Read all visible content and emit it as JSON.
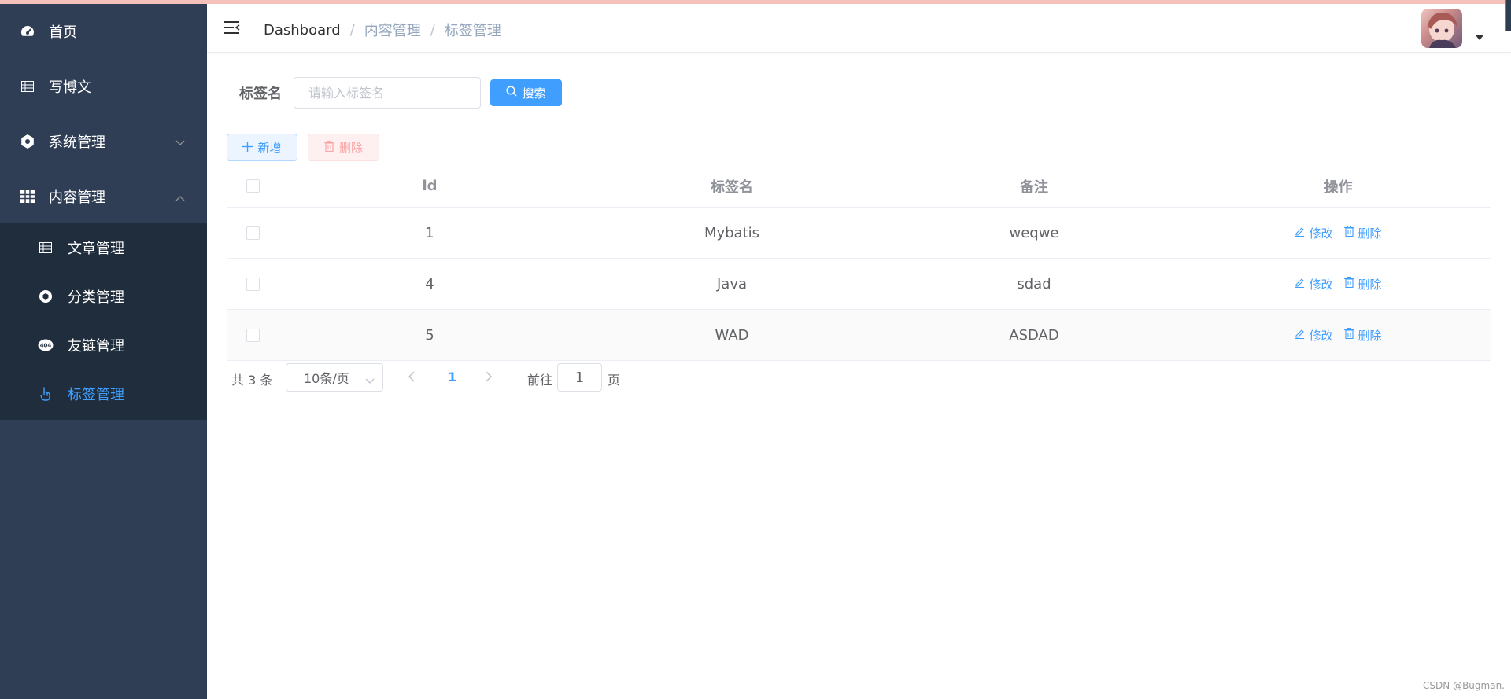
{
  "sidebar": {
    "items": [
      {
        "label": "首页",
        "icon": "dashboard-icon"
      },
      {
        "label": "写博文",
        "icon": "table-icon"
      },
      {
        "label": "系统管理",
        "icon": "gear-icon"
      },
      {
        "label": "内容管理",
        "icon": "grid-icon"
      }
    ],
    "sub_items": [
      {
        "label": "文章管理",
        "icon": "table-icon"
      },
      {
        "label": "分类管理",
        "icon": "aperture-icon"
      },
      {
        "label": "友链管理",
        "icon": "404-icon"
      },
      {
        "label": "标签管理",
        "icon": "pointer-icon",
        "active": true
      }
    ]
  },
  "header": {
    "breadcrumb": [
      "Dashboard",
      "内容管理",
      "标签管理"
    ],
    "separator": "/"
  },
  "search": {
    "label": "标签名",
    "placeholder": "请输入标签名",
    "button": "搜索"
  },
  "toolbar": {
    "add": "新增",
    "delete": "删除"
  },
  "table": {
    "columns": [
      "id",
      "标签名",
      "备注",
      "操作"
    ],
    "rows": [
      {
        "id": "1",
        "name": "Mybatis",
        "note": "weqwe"
      },
      {
        "id": "4",
        "name": "Java",
        "note": "sdad"
      },
      {
        "id": "5",
        "name": "WAD",
        "note": "ASDAD"
      }
    ],
    "edit_label": "修改",
    "delete_label": "删除"
  },
  "pagination": {
    "total": "共 3 条",
    "page_size": "10条/页",
    "current_page": "1",
    "goto_prefix": "前往",
    "goto_value": "1",
    "goto_suffix": "页"
  },
  "watermark": "CSDN @Bugman.",
  "colors": {
    "sidebar_bg": "#2f3e54",
    "submenu_bg": "#1f2d3d",
    "accent": "#409eff",
    "danger_light": "#fef0f0"
  }
}
